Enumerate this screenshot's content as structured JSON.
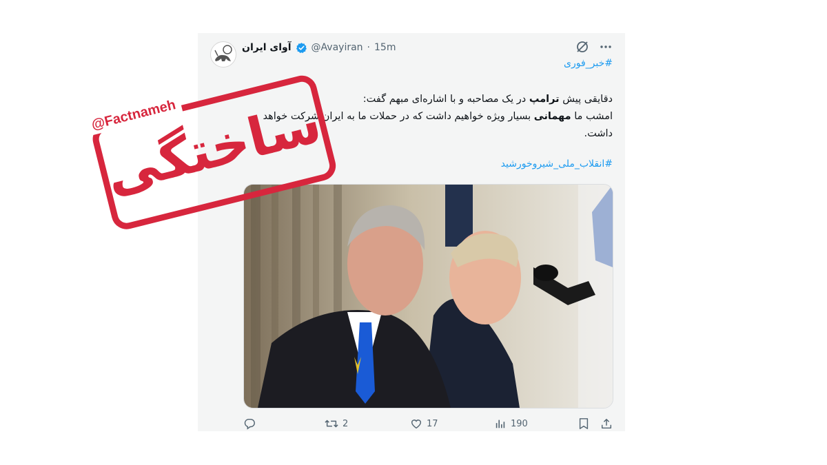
{
  "tweet": {
    "display_name": "آوای ایران",
    "handle": "@Avayiran",
    "separator": "·",
    "time": "15m",
    "hashtag_top": "#خبر_فوری",
    "text_line1_pre": "دقایقی پیش ",
    "text_line1_bold": "ترامپ",
    "text_line1_post": " در یک مصاحبه و با اشاره‌ای مبهم گفت:",
    "text_line2_pre": "امشب ما ",
    "text_line2_bold": "مهمانی",
    "text_line2_post": " بسیار ویژه خواهیم داشت که در حملات ما به ایران شرکت خواهد داشت.",
    "hashtag_bottom": "#انقلاب_ملی_شیروخورشید",
    "icons": [
      "grok-icon",
      "more-icon",
      "reply-icon",
      "retweet-icon",
      "like-icon",
      "views-icon",
      "bookmark-icon",
      "share-icon"
    ],
    "retweets": "2",
    "likes": "17",
    "views": "190"
  },
  "stamp": {
    "handle": "@Factnameh",
    "label": "ساختگی",
    "color": "#d7263d"
  },
  "colors": {
    "link": "#1d9bf0",
    "muted": "#536471",
    "verified": "#1d9bf0"
  }
}
